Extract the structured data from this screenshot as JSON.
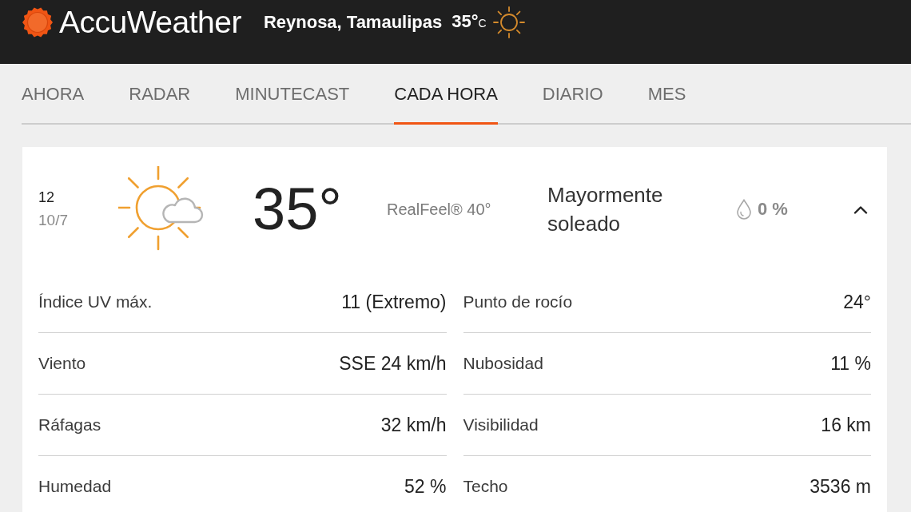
{
  "header": {
    "logo": "AccuWeather",
    "location": "Reynosa, Tamaulipas",
    "temperature": "35°",
    "unit": "C"
  },
  "tabs": [
    {
      "label": "AHORA",
      "selected": false
    },
    {
      "label": "RADAR",
      "selected": false
    },
    {
      "label": "MINUTECAST",
      "selected": false
    },
    {
      "label": "CADA HORA",
      "selected": true
    },
    {
      "label": "DIARIO",
      "selected": false
    },
    {
      "label": "MES",
      "selected": false
    }
  ],
  "hourly_card": {
    "expanded": true,
    "hour": "12",
    "date": "10/7",
    "temperature": "35°",
    "realfeel": "RealFeel® 40°",
    "phrase": "Mayormente soleado",
    "precipitation": "0 %",
    "details": [
      {
        "label": "Índice UV máx.",
        "value": "11 (Extremo)"
      },
      {
        "label": "Punto de rocío",
        "value": "24°"
      },
      {
        "label": "Viento",
        "value": "SSE 24 km/h"
      },
      {
        "label": "Nubosidad",
        "value": "11 %"
      },
      {
        "label": "Ráfagas",
        "value": "32 km/h"
      },
      {
        "label": "Visibilidad",
        "value": "16 km"
      },
      {
        "label": "Humedad",
        "value": "52 %"
      },
      {
        "label": "Techo",
        "value": "3536 m"
      }
    ]
  }
}
